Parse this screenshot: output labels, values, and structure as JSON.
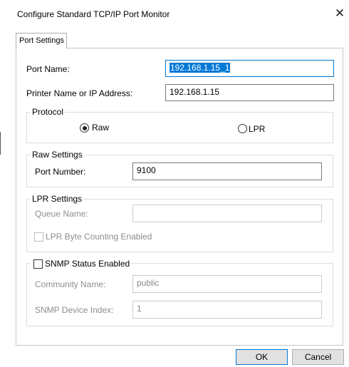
{
  "window": {
    "title": "Configure Standard TCP/IP Port Monitor",
    "close_glyph": "✕"
  },
  "tabs": [
    {
      "label": "Port Settings",
      "selected": true
    }
  ],
  "port_name": {
    "label": "Port Name:",
    "value": "192.168.1.15_1"
  },
  "printer_address": {
    "label": "Printer Name or IP Address:",
    "value": "192.168.1.15"
  },
  "protocol": {
    "legend": "Protocol",
    "options": [
      {
        "label": "Raw",
        "selected": true
      },
      {
        "label": "LPR",
        "selected": false
      }
    ]
  },
  "raw_settings": {
    "legend": "Raw Settings",
    "port_number_label": "Port Number:",
    "port_number_value": "9100"
  },
  "lpr_settings": {
    "legend": "LPR Settings",
    "queue_name_label": "Queue Name:",
    "queue_name_value": "",
    "byte_counting_label": "LPR Byte Counting Enabled",
    "byte_counting_checked": false
  },
  "snmp": {
    "legend": "SNMP Status Enabled",
    "checked": false,
    "community_label": "Community Name:",
    "community_value": "public",
    "device_index_label": "SNMP Device Index:",
    "device_index_value": "1"
  },
  "buttons": {
    "ok": "OK",
    "cancel": "Cancel"
  },
  "colors": {
    "accent": "#0078d7",
    "button_face": "#e1e1e1",
    "disabled_text": "#8d8d8d"
  }
}
